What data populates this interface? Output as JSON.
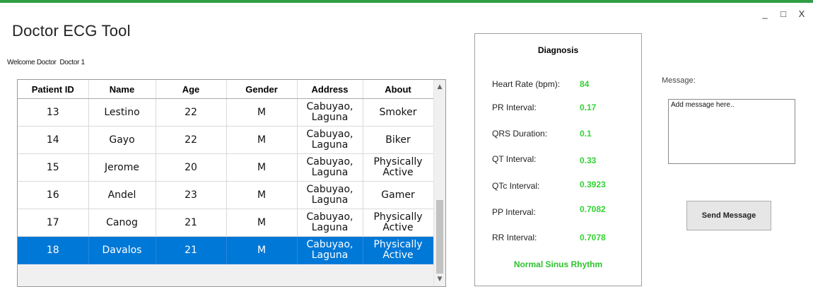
{
  "window": {
    "title": "Doctor ECG Tool",
    "controls": {
      "minimize": "_",
      "maximize": "□",
      "close": "X"
    }
  },
  "welcome": {
    "prefix": "Welcome Doctor",
    "name": "Doctor 1"
  },
  "patients": {
    "columns": [
      "Patient ID",
      "Name",
      "Age",
      "Gender",
      "Address",
      "About"
    ],
    "rows": [
      {
        "id": "13",
        "name": "Lestino",
        "age": "22",
        "gender": "M",
        "address": "Cabuyao, Laguna",
        "about": "Smoker"
      },
      {
        "id": "14",
        "name": "Gayo",
        "age": "22",
        "gender": "M",
        "address": "Cabuyao, Laguna",
        "about": "Biker"
      },
      {
        "id": "15",
        "name": "Jerome",
        "age": "20",
        "gender": "M",
        "address": "Cabuyao, Laguna",
        "about": "Physically Active"
      },
      {
        "id": "16",
        "name": "Andel",
        "age": "23",
        "gender": "M",
        "address": "Cabuyao, Laguna",
        "about": "Gamer"
      },
      {
        "id": "17",
        "name": "Canog",
        "age": "21",
        "gender": "M",
        "address": "Cabuyao, Laguna",
        "about": "Physically Active"
      },
      {
        "id": "18",
        "name": "Davalos",
        "age": "21",
        "gender": "M",
        "address": "Cabuyao, Laguna",
        "about": "Physically Active"
      }
    ],
    "selected_id": "18",
    "selection_color": "#0078d7"
  },
  "diagnosis": {
    "title": "Diagnosis",
    "heart_rate": {
      "label": "Heart Rate (bpm):",
      "value": "84"
    },
    "pr_interval": {
      "label": "PR Interval:",
      "value": "0.17"
    },
    "qrs_duration": {
      "label": "QRS Duration:",
      "value": "0.1"
    },
    "qt_interval": {
      "label": "QT Interval:",
      "value": "0.33"
    },
    "qtc_interval": {
      "label": "QTc Interval:",
      "value": "0.3923"
    },
    "pp_interval": {
      "label": "PP Interval:",
      "value": "0.7082"
    },
    "rr_interval": {
      "label": "RR Interval:",
      "value": "0.7078"
    },
    "rhythm": "Normal Sinus Rhythm",
    "value_color": "#32d432"
  },
  "message": {
    "label": "Message:",
    "value": "Add message here..",
    "send_label": "Send Message"
  },
  "accent_color": "#2f9e44"
}
